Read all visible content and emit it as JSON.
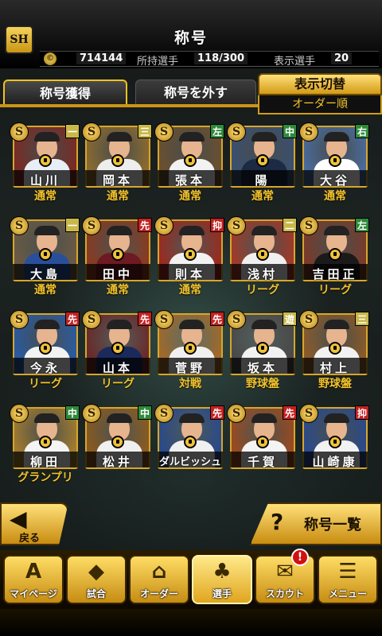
{
  "header": {
    "title": "称号",
    "logo_text": "SH",
    "coin_icon": "coin-icon",
    "coins": "714144",
    "owned_label": "所持選手",
    "owned_value": "118/300",
    "display_label": "表示選手",
    "display_value": "20"
  },
  "tabs": [
    {
      "label": "称号獲得"
    },
    {
      "label": "称号を外す"
    }
  ],
  "display_switch": {
    "title": "表示切替",
    "order": "オーダー順"
  },
  "cards": [
    {
      "name": "山川",
      "rarity": "通常",
      "pos": "一",
      "pos_color": "#c8b84a",
      "uniform": "#e8eef6",
      "bg": "#7b2a24"
    },
    {
      "name": "岡本",
      "rarity": "通常",
      "pos": "三",
      "pos_color": "#c8b84a",
      "uniform": "#eeeeee",
      "bg": "#8a6a30"
    },
    {
      "name": "張本",
      "rarity": "通常",
      "pos": "左",
      "pos_color": "#2e8a3a",
      "uniform": "#f2f2f2",
      "bg": "#6a5030"
    },
    {
      "name": "陽",
      "rarity": "通常",
      "pos": "中",
      "pos_color": "#2e8a3a",
      "uniform": "#1c2a44",
      "bg": "#3a5070"
    },
    {
      "name": "大谷",
      "rarity": "通常",
      "pos": "右",
      "pos_color": "#2e8a3a",
      "uniform": "#ffffff",
      "bg": "#4a6a9a"
    },
    {
      "name": "大島",
      "rarity": "通常",
      "pos": "一",
      "pos_color": "#c8b84a",
      "uniform": "#2a4f9a",
      "bg": "#6a5a44"
    },
    {
      "name": "田中",
      "rarity": "通常",
      "pos": "先",
      "pos_color": "#c42020",
      "uniform": "#6e1a22",
      "bg": "#8a3a20"
    },
    {
      "name": "則本",
      "rarity": "通常",
      "pos": "抑",
      "pos_color": "#c42020",
      "uniform": "#f2f2f2",
      "bg": "#9a2a20"
    },
    {
      "name": "浅村",
      "rarity": "リーグ",
      "pos": "二",
      "pos_color": "#c8b84a",
      "uniform": "#f0f0f0",
      "bg": "#a03a2a"
    },
    {
      "name": "吉田正",
      "rarity": "リーグ",
      "pos": "左",
      "pos_color": "#2e8a3a",
      "uniform": "#1a1a1a",
      "bg": "#7a3a2a"
    },
    {
      "name": "今永",
      "rarity": "リーグ",
      "pos": "先",
      "pos_color": "#c42020",
      "uniform": "#f2f2f2",
      "bg": "#2a5aa0"
    },
    {
      "name": "山本",
      "rarity": "リーグ",
      "pos": "先",
      "pos_color": "#c42020",
      "uniform": "#1a2a5a",
      "bg": "#6a2a2a"
    },
    {
      "name": "菅野",
      "rarity": "対戦",
      "pos": "先",
      "pos_color": "#c42020",
      "uniform": "#f0f0f0",
      "bg": "#a06a2a"
    },
    {
      "name": "坂本",
      "rarity": "野球盤",
      "pos": "遊",
      "pos_color": "#c8b84a",
      "uniform": "#f2f2f2",
      "bg": "#4a4a4a"
    },
    {
      "name": "村上",
      "rarity": "野球盤",
      "pos": "三",
      "pos_color": "#c8b84a",
      "uniform": "#f2f2f2",
      "bg": "#8a5a2a"
    },
    {
      "name": "柳田",
      "rarity": "グランプリ",
      "pos": "中",
      "pos_color": "#2e8a3a",
      "uniform": "#f4f4f4",
      "bg": "#a07a30"
    },
    {
      "name": "松井",
      "rarity": "",
      "pos": "中",
      "pos_color": "#2e8a3a",
      "uniform": "#f0f0f0",
      "bg": "#8a5a20"
    },
    {
      "name": "ダルビッシュ",
      "rarity": "",
      "pos": "先",
      "pos_color": "#c42020",
      "uniform": "#f0f0f0",
      "bg": "#2a4a8a"
    },
    {
      "name": "千賀",
      "rarity": "",
      "pos": "先",
      "pos_color": "#c42020",
      "uniform": "#f4f4f4",
      "bg": "#9a4a20"
    },
    {
      "name": "山崎康",
      "rarity": "",
      "pos": "抑",
      "pos_color": "#c42020",
      "uniform": "#f2f2f2",
      "bg": "#2a4a8a"
    }
  ],
  "card_badge_letter": "S",
  "buttons": {
    "back": "戻る",
    "back_icon": "back-arrow-icon",
    "list": "称号一覧",
    "list_icon": "question-icon"
  },
  "nav": [
    {
      "label": "マイページ",
      "icon": "home-icon",
      "glyph": "A"
    },
    {
      "label": "試合",
      "icon": "diamond-icon",
      "glyph": "◆"
    },
    {
      "label": "オーダー",
      "icon": "field-icon",
      "glyph": "⌂"
    },
    {
      "label": "選手",
      "icon": "player-icon",
      "glyph": "♣"
    },
    {
      "label": "スカウト",
      "icon": "scout-icon",
      "glyph": "✉"
    },
    {
      "label": "メニュー",
      "icon": "menu-icon",
      "glyph": "☰"
    }
  ],
  "scout_notification": "!"
}
